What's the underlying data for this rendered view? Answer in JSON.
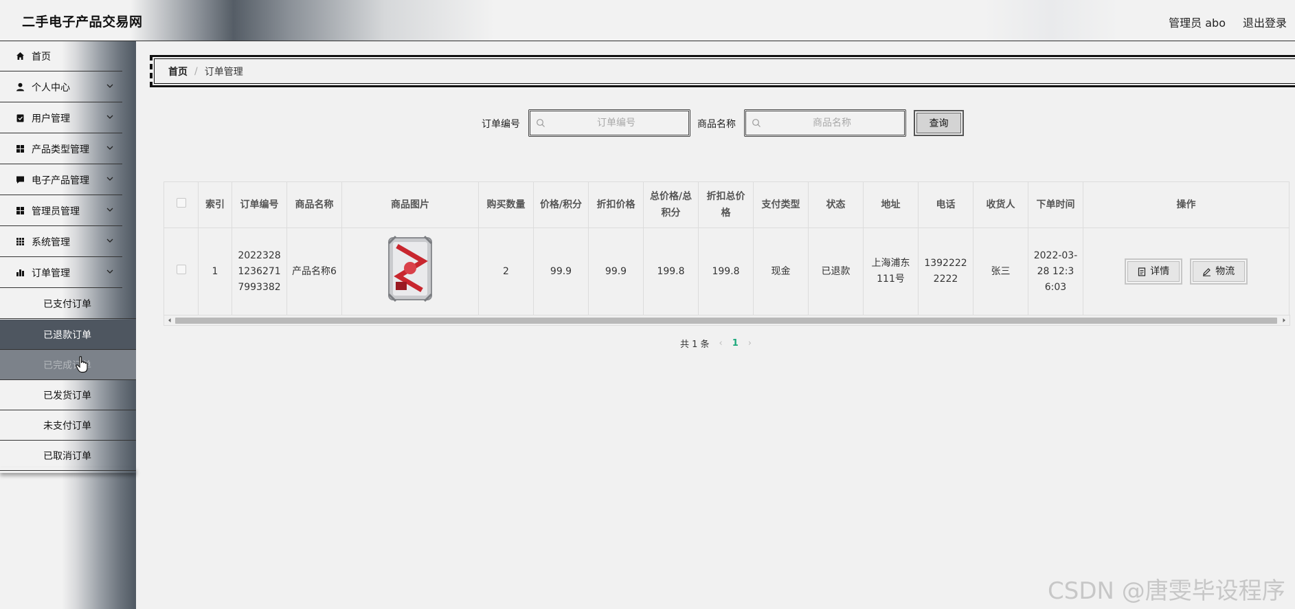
{
  "header": {
    "title": "二手电子产品交易网",
    "user": "管理员 abo",
    "logout": "退出登录"
  },
  "sidebar": {
    "items": [
      {
        "label": "首页",
        "icon": "home-icon"
      },
      {
        "label": "个人中心",
        "icon": "person-icon"
      },
      {
        "label": "用户管理",
        "icon": "clipboard-icon"
      },
      {
        "label": "产品类型管理",
        "icon": "grid-icon"
      },
      {
        "label": "电子产品管理",
        "icon": "chat-icon"
      },
      {
        "label": "管理员管理",
        "icon": "grid-icon"
      },
      {
        "label": "系统管理",
        "icon": "apps-icon"
      },
      {
        "label": "订单管理",
        "icon": "bar-chart-icon"
      }
    ],
    "sub_items": [
      "已支付订单",
      "已退款订单",
      "已完成订单",
      "已发货订单",
      "未支付订单",
      "已取消订单"
    ],
    "active_sub": "已退款订单"
  },
  "breadcrumb": {
    "home": "首页",
    "separator": "/",
    "current": "订单管理"
  },
  "search": {
    "order_label": "订单编号",
    "order_placeholder": "订单编号",
    "product_label": "商品名称",
    "product_placeholder": "商品名称",
    "button": "查询"
  },
  "table": {
    "headers": [
      "索引",
      "订单编号",
      "商品名称",
      "商品图片",
      "购买数量",
      "价格/积分",
      "折扣价格",
      "总价格/总积分",
      "折扣总价格",
      "支付类型",
      "状态",
      "地址",
      "电话",
      "收货人",
      "下单时间",
      "操作"
    ],
    "rows": [
      {
        "index": "1",
        "order_no": "202232812362717993382",
        "product_name": "产品名称6",
        "quantity": "2",
        "price": "99.9",
        "discount_price": "99.9",
        "total": "199.8",
        "discount_total": "199.8",
        "pay_type": "现金",
        "status": "已退款",
        "address": "上海浦东111号",
        "phone": "13922222222",
        "receiver": "张三",
        "order_time": "2022-03-28 12:36:03"
      }
    ],
    "actions": {
      "detail": "详情",
      "logistics": "物流"
    }
  },
  "pagination": {
    "total": "共 1 条",
    "current": "1"
  },
  "watermark": "CSDN @唐雯毕设程序"
}
